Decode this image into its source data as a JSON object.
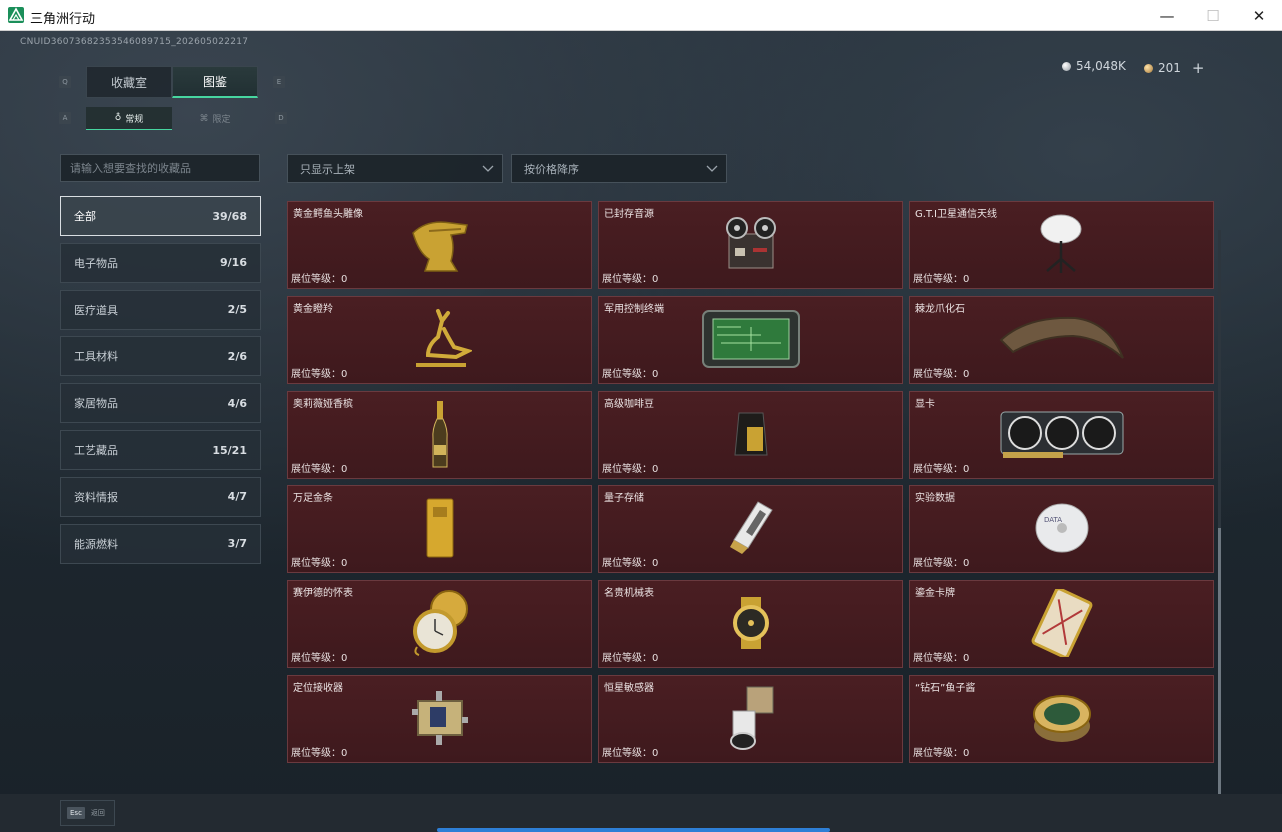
{
  "window": {
    "title": "三角洲行动",
    "minimize_glyph": "—",
    "maximize_glyph": "☐",
    "close_glyph": "✕"
  },
  "header": {
    "uid": "CNUID3607368235354608971​5_202605022217",
    "silver": "54,048K",
    "gold": "201",
    "plus": "+"
  },
  "main_tabs": [
    {
      "label": "收藏室",
      "key": "Q"
    },
    {
      "label": "图鉴",
      "key": "E"
    }
  ],
  "sub_tabs": [
    {
      "label": "常规",
      "key": "A"
    },
    {
      "label": "限定",
      "key": "D"
    }
  ],
  "search": {
    "placeholder": "请输入想要查找的收藏品"
  },
  "filters": {
    "shelf": "只显示上架",
    "sort": "按价格降序"
  },
  "categories": [
    {
      "label": "全部",
      "count": "39/68"
    },
    {
      "label": "电子物品",
      "count": "9/16"
    },
    {
      "label": "医疗道具",
      "count": "2/5"
    },
    {
      "label": "工具材料",
      "count": "2/6"
    },
    {
      "label": "家居物品",
      "count": "4/6"
    },
    {
      "label": "工艺藏品",
      "count": "15/21"
    },
    {
      "label": "资料情报",
      "count": "4/7"
    },
    {
      "label": "能源燃料",
      "count": "3/7"
    }
  ],
  "level_label": "展位等级：0",
  "items": [
    {
      "name": "黄金鳄鱼头雕像",
      "icon": "gold-crocodile-head-icon"
    },
    {
      "name": "已封存音源",
      "icon": "tape-recorder-icon"
    },
    {
      "name": "G.T.I卫星通信天线",
      "icon": "satellite-dish-icon"
    },
    {
      "name": "黄金瞪羚",
      "icon": "gold-gazelle-icon"
    },
    {
      "name": "军用控制终端",
      "icon": "control-terminal-icon"
    },
    {
      "name": "棘龙爪化石",
      "icon": "claw-fossil-icon"
    },
    {
      "name": "奥莉薇娅香槟",
      "icon": "champagne-bottle-icon"
    },
    {
      "name": "高级咖啡豆",
      "icon": "coffee-bag-icon"
    },
    {
      "name": "显卡",
      "icon": "graphics-card-icon"
    },
    {
      "name": "万足金条",
      "icon": "gold-bar-icon"
    },
    {
      "name": "量子存储",
      "icon": "usb-drive-icon"
    },
    {
      "name": "实验数据",
      "icon": "disc-icon"
    },
    {
      "name": "赛伊德的怀表",
      "icon": "pocket-watch-icon"
    },
    {
      "name": "名贵机械表",
      "icon": "wrist-watch-icon"
    },
    {
      "name": "鎏金卡牌",
      "icon": "gilded-card-icon"
    },
    {
      "name": "定位接收器",
      "icon": "gps-receiver-icon"
    },
    {
      "name": "恒星敏感器",
      "icon": "star-sensor-icon"
    },
    {
      "name": "“钻石”鱼子酱",
      "icon": "caviar-tin-icon"
    }
  ],
  "footer": {
    "esc_key": "Esc",
    "back_label": "返回"
  },
  "colors": {
    "accent": "#47d6a0",
    "card_bg": "#4a1e22",
    "card_border": "#6a3a3f"
  }
}
